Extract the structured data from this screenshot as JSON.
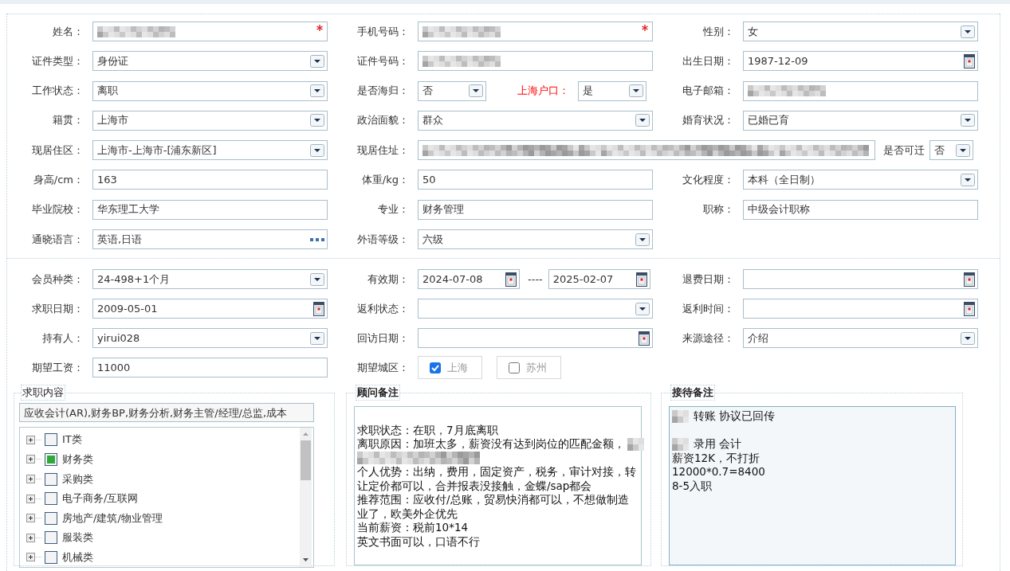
{
  "sections": [
    {
      "rows": [
        [
          {
            "label": "姓名：",
            "controls": [
              {
                "kind": "text",
                "masked": true,
                "required": true
              }
            ]
          },
          {
            "label": "手机号码：",
            "controls": [
              {
                "kind": "text",
                "masked": true,
                "required": true
              }
            ]
          },
          {
            "label": "性别：",
            "controls": [
              {
                "kind": "select",
                "value": "女",
                "required": false
              }
            ]
          }
        ],
        [
          {
            "label": "证件类型：",
            "controls": [
              {
                "kind": "select",
                "value": "身份证",
                "required": false
              }
            ]
          },
          {
            "label": "证件号码：",
            "controls": [
              {
                "kind": "text",
                "masked": true,
                "required": false
              }
            ]
          },
          {
            "label": "出生日期：",
            "controls": [
              {
                "kind": "date",
                "value": "1987-12-09",
                "required": false
              }
            ]
          }
        ],
        [
          {
            "label": "工作状态：",
            "controls": [
              {
                "kind": "select",
                "value": "离职",
                "required": false
              }
            ]
          },
          {
            "label": "是否海归：",
            "controls": [
              {
                "kind": "select",
                "value": "否",
                "required": false
              },
              {
                "kind": "label",
                "text": "上海户口：",
                "alert": true
              },
              {
                "kind": "select",
                "value": "是",
                "required": false
              }
            ]
          },
          {
            "label": "电子邮箱：",
            "controls": [
              {
                "kind": "text",
                "masked": true,
                "required": false
              }
            ]
          }
        ],
        [
          {
            "label": "籍贯：",
            "controls": [
              {
                "kind": "select",
                "value": "上海市",
                "required": false
              }
            ]
          },
          {
            "label": "政治面貌：",
            "controls": [
              {
                "kind": "select",
                "value": "群众",
                "required": false
              }
            ]
          },
          {
            "label": "婚育状况：",
            "controls": [
              {
                "kind": "select",
                "value": "已婚已育",
                "required": false
              }
            ]
          }
        ],
        [
          {
            "label": "现居住区：",
            "controls": [
              {
                "kind": "select",
                "value": "上海市-上海市-[浦东新区]",
                "required": false
              }
            ]
          },
          {
            "label": "现居住址：",
            "wide": true,
            "controls": [
              {
                "kind": "text",
                "masked": true,
                "required": false
              },
              {
                "kind": "label",
                "text": "是否可迁",
                "alert": false
              },
              {
                "kind": "select",
                "value": "否",
                "required": false
              }
            ]
          }
        ],
        [
          {
            "label": "身高/cm：",
            "controls": [
              {
                "kind": "text",
                "value": "163",
                "required": false
              }
            ]
          },
          {
            "label": "体重/kg：",
            "controls": [
              {
                "kind": "text",
                "value": "50",
                "required": false
              }
            ]
          },
          {
            "label": "文化程度：",
            "controls": [
              {
                "kind": "select",
                "value": "本科（全日制）",
                "required": false
              }
            ]
          }
        ],
        [
          {
            "label": "毕业院校：",
            "controls": [
              {
                "kind": "text",
                "value": "华东理工大学",
                "required": false
              }
            ]
          },
          {
            "label": "专业：",
            "controls": [
              {
                "kind": "text",
                "value": "财务管理",
                "required": false
              }
            ]
          },
          {
            "label": "职称：",
            "controls": [
              {
                "kind": "text",
                "value": "中级会计职称",
                "required": false
              }
            ]
          }
        ],
        [
          {
            "label": "通晓语言：",
            "controls": [
              {
                "kind": "lookup",
                "value": "英语,日语",
                "required": false
              }
            ]
          },
          {
            "label": "外语等级：",
            "controls": [
              {
                "kind": "select",
                "value": "六级",
                "required": false
              }
            ]
          }
        ]
      ]
    },
    {
      "rows": [
        [
          {
            "label": "会员种类：",
            "controls": [
              {
                "kind": "select",
                "value": "24-498+1个月",
                "required": false
              }
            ]
          },
          {
            "label": "有效期：",
            "controls": [
              {
                "kind": "date",
                "value": "2024-07-08",
                "required": false
              },
              {
                "kind": "sep",
                "text": "----"
              },
              {
                "kind": "date",
                "value": "2025-02-07",
                "required": false
              }
            ]
          },
          {
            "label": "退费日期：",
            "controls": [
              {
                "kind": "date",
                "required": false
              }
            ]
          }
        ],
        [
          {
            "label": "求职日期：",
            "controls": [
              {
                "kind": "date",
                "value": "2009-05-01",
                "required": false
              }
            ]
          },
          {
            "label": "返利状态：",
            "controls": [
              {
                "kind": "select",
                "required": false
              }
            ]
          },
          {
            "label": "返利时间：",
            "controls": [
              {
                "kind": "date",
                "required": false
              }
            ]
          }
        ],
        [
          {
            "label": "持有人：",
            "controls": [
              {
                "kind": "select",
                "value": "yirui028",
                "required": false
              }
            ]
          },
          {
            "label": "回访日期：",
            "controls": [
              {
                "kind": "date",
                "required": false
              }
            ]
          },
          {
            "label": "来源途径：",
            "controls": [
              {
                "kind": "select",
                "value": "介绍",
                "required": false
              }
            ]
          }
        ],
        [
          {
            "label": "期望工资：",
            "controls": [
              {
                "kind": "text",
                "value": "11000",
                "required": false
              }
            ]
          },
          {
            "label": "期望城区：",
            "controls": [
              {
                "kind": "check",
                "text": "上海",
                "checked": true
              },
              {
                "kind": "check",
                "text": "苏州",
                "checked": false
              }
            ]
          }
        ]
      ]
    }
  ],
  "panels": [
    {
      "kind": "tree",
      "title": "求职内容",
      "summary": "应收会计(AR),财务BP,财务分析,财务主管/经理/总监,成本",
      "items": [
        {
          "label": "IT类",
          "checked": false,
          "expanded": false
        },
        {
          "label": "财务类",
          "checked": true,
          "expanded": false
        },
        {
          "label": "采购类",
          "checked": false,
          "expanded": false
        },
        {
          "label": "电子商务/互联网",
          "checked": false,
          "expanded": false
        },
        {
          "label": "房地产/建筑/物业管理",
          "checked": false,
          "expanded": false
        },
        {
          "label": "服装类",
          "checked": false,
          "expanded": false
        },
        {
          "label": "机械类",
          "checked": false,
          "expanded": false
        }
      ]
    },
    {
      "kind": "notes",
      "title": "顾问备注",
      "focused": false,
      "lines": [
        {
          "kind": "blank"
        },
        {
          "kind": "line",
          "segments": [
            {
              "kind": "text",
              "text": "求职状态：在职，7月底离职"
            }
          ]
        },
        {
          "kind": "line",
          "segments": [
            {
              "kind": "text",
              "text": "离职原因：加班太多，薪资没有达到岗位的匹配金额，"
            },
            {
              "kind": "mask"
            }
          ]
        },
        {
          "kind": "line",
          "segments": [
            {
              "kind": "mask"
            }
          ]
        },
        {
          "kind": "line",
          "segments": [
            {
              "kind": "text",
              "text": "个人优势：出纳，费用，固定资产，税务，审计对接，转"
            }
          ]
        },
        {
          "kind": "line",
          "segments": [
            {
              "kind": "text",
              "text": "让定价都可以，合并报表没接触，金蝶/sap都会"
            }
          ]
        },
        {
          "kind": "line",
          "segments": [
            {
              "kind": "text",
              "text": "推荐范围：应收付/总账，贸易快消都可以，不想做制造"
            }
          ]
        },
        {
          "kind": "line",
          "segments": [
            {
              "kind": "text",
              "text": "业了，欧美外企优先"
            }
          ]
        },
        {
          "kind": "line",
          "segments": [
            {
              "kind": "text",
              "text": "当前薪资：税前10*14"
            }
          ]
        },
        {
          "kind": "line",
          "segments": [
            {
              "kind": "text",
              "text": "英文书面可以，口语不行"
            }
          ]
        }
      ]
    },
    {
      "kind": "notes",
      "title": "接待备注",
      "focused": true,
      "lines": [
        {
          "kind": "line",
          "segments": [
            {
              "kind": "mask"
            },
            {
              "kind": "text",
              "text": "转账 协议已回传"
            }
          ]
        },
        {
          "kind": "blank"
        },
        {
          "kind": "line",
          "segments": [
            {
              "kind": "mask"
            },
            {
              "kind": "text",
              "text": "录用  会计"
            }
          ]
        },
        {
          "kind": "line",
          "segments": [
            {
              "kind": "text",
              "text": "薪资12K，不打折"
            }
          ]
        },
        {
          "kind": "line",
          "segments": [
            {
              "kind": "text",
              "text": "12000*0.7=8400"
            }
          ]
        },
        {
          "kind": "line",
          "segments": [
            {
              "kind": "text",
              "text": "8-5入职"
            }
          ]
        }
      ]
    }
  ]
}
